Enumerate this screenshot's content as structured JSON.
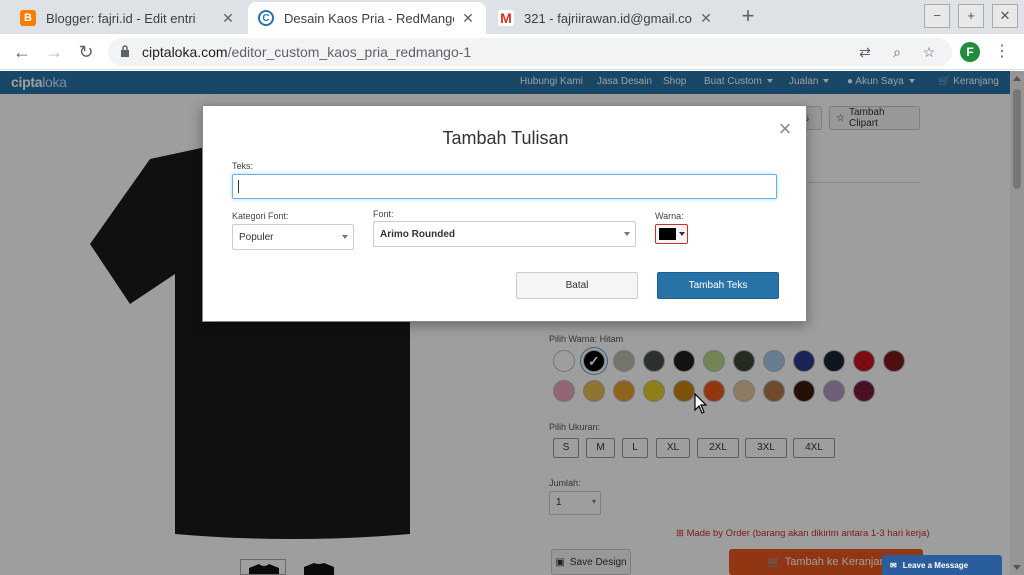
{
  "browser": {
    "tabs": [
      {
        "title": "Blogger: fajri.id - Edit entri",
        "favicon": "blogger-icon",
        "active": false
      },
      {
        "title": "Desain Kaos Pria - RedMango C",
        "favicon": "ciptaloka-icon",
        "active": true
      },
      {
        "title": "321 - fajriirawan.id@gmail.com",
        "favicon": "gmail-icon",
        "active": false
      }
    ],
    "url_domain": "ciptaloka.com",
    "url_path": "/editor_custom_kaos_pria_redmango-1",
    "profile_initial": "F"
  },
  "site": {
    "brand_part1": "cipta",
    "brand_part2": "loka",
    "nav": {
      "hubungi": "Hubungi Kami",
      "jasa": "Jasa Desain",
      "shop": "Shop",
      "buat": "Buat Custom",
      "jualan": "Jualan",
      "akun": "Akun Saya",
      "keranjang": "Keranjang"
    }
  },
  "toolbar": {
    "teks_partial": "ks",
    "clipart": "Tambah Clipart"
  },
  "product": {
    "color_label": "Pilih Warna: Hitam",
    "colors_row1": [
      "#ffffff",
      "#000000",
      "#bdbdb5",
      "#4a4f4a",
      "#1e1e22",
      "#b8d88a",
      "#3a4632",
      "#a9cbe8",
      "#2b3a8c",
      "#1c2236",
      "#c8141a",
      "#7b1a1a"
    ],
    "colors_row2": [
      "#efa4b8",
      "#e6bd4e",
      "#e8a22a",
      "#e8cc2c",
      "#c98414",
      "#e85a1a",
      "#e8c8a0",
      "#b07a48",
      "#3a1a0c",
      "#b098c4",
      "#7a1a3a"
    ],
    "selected_color_index": 1,
    "size_label": "Pilih Ukuran:",
    "sizes": [
      "S",
      "M",
      "L",
      "XL",
      "2XL",
      "3XL",
      "4XL"
    ],
    "qty_label": "Jumlah:",
    "qty_value": "1",
    "made_order": "Made by Order (barang akan dikirim antara 1-3 hari kerja)",
    "save_design": "Save Design",
    "add_cart": "Tambah ke Keranjang",
    "leave_message": "Leave a Message"
  },
  "modal": {
    "title": "Tambah Tulisan",
    "text_label": "Teks:",
    "text_value": "",
    "font_category_label": "Kategori Font:",
    "font_category_value": "Populer",
    "font_label": "Font:",
    "font_value": "Arimo Rounded",
    "color_label": "Warna:",
    "color_value": "#000000",
    "cancel": "Batal",
    "submit": "Tambah Teks"
  }
}
